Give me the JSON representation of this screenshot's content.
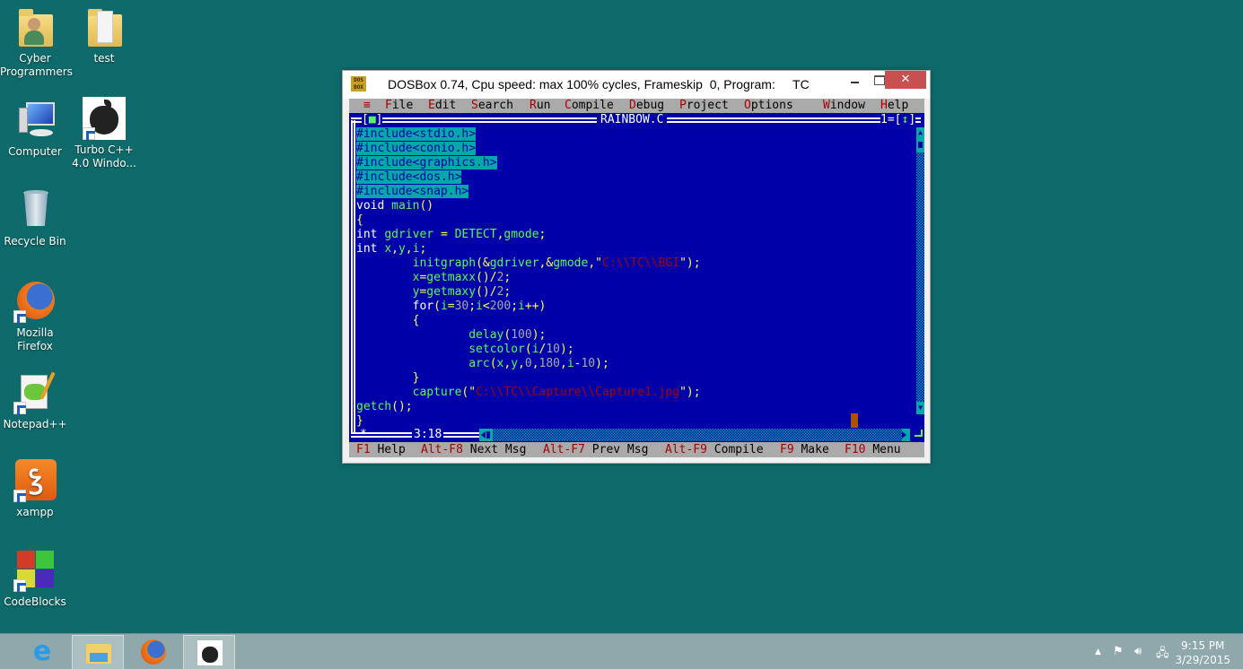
{
  "desktop": {
    "icons": [
      {
        "label_1": "Cyber",
        "label_2": "Programmers",
        "icon": "user-folder-icon"
      },
      {
        "label_1": "test",
        "label_2": "",
        "icon": "folder-icon"
      },
      {
        "label_1": "Computer",
        "label_2": "",
        "icon": "computer-icon"
      },
      {
        "label_1": "Turbo C++",
        "label_2": "4.0 Windo...",
        "icon": "turbo-cpp-shortcut-icon"
      },
      {
        "label_1": "Recycle Bin",
        "label_2": "",
        "icon": "recycle-bin-icon"
      },
      {
        "label_1": "Mozilla",
        "label_2": "Firefox",
        "icon": "firefox-icon"
      },
      {
        "label_1": "Notepad++",
        "label_2": "",
        "icon": "notepadpp-icon"
      },
      {
        "label_1": "xampp",
        "label_2": "",
        "icon": "xampp-icon"
      },
      {
        "label_1": "CodeBlocks",
        "label_2": "",
        "icon": "codeblocks-icon"
      }
    ]
  },
  "window": {
    "title": "DOSBox 0.74, Cpu speed: max 100% cycles, Frameskip  0, Program:     TC",
    "logo_top": "DOS",
    "logo_bottom": "BOX",
    "close_glyph": "✕"
  },
  "tc": {
    "menu": [
      {
        "hotkey": "≡",
        "rest": ""
      },
      {
        "hotkey": "F",
        "rest": "ile"
      },
      {
        "hotkey": "E",
        "rest": "dit"
      },
      {
        "hotkey": "S",
        "rest": "earch"
      },
      {
        "hotkey": "R",
        "rest": "un"
      },
      {
        "hotkey": "C",
        "rest": "ompile"
      },
      {
        "hotkey": "D",
        "rest": "ebug"
      },
      {
        "hotkey": "P",
        "rest": "roject"
      },
      {
        "hotkey": "O",
        "rest": "ptions"
      },
      {
        "hotkey": "W",
        "rest": "indow"
      },
      {
        "hotkey": "H",
        "rest": "elp"
      }
    ],
    "close_box_left": "[",
    "close_box_mark": "■",
    "close_box_right": "]",
    "file_name": "RAINBOW.C",
    "window_number": "1=[",
    "zoom_glyph": "↕",
    "window_number_end": "]",
    "cursor_position": "3:18",
    "code": [
      "#include<stdio.h>",
      "#include<conio.h>",
      "#include<graphics.h>",
      "#include<dos.h>",
      "#include<snap.h>",
      "void main()",
      "{",
      "int gdriver = DETECT,gmode;",
      "int x,y,i;",
      "        initgraph(&gdriver,&gmode,\"C:\\\\TC\\\\BGI\");",
      "        x=getmaxx()/2;",
      "        y=getmaxy()/2;",
      "        for(i=30;i<200;i++)",
      "        {",
      "                delay(100);",
      "                setcolor(i/10);",
      "                arc(x,y,0,180,i-10);",
      "        }",
      "        capture(\"C:\\\\TC\\\\Capture\\\\Capture1.jpg\");",
      "getch();",
      "}"
    ],
    "status": [
      {
        "key": "F1",
        "label": "Help"
      },
      {
        "key": "Alt-F8",
        "label": "Next Msg"
      },
      {
        "key": "Alt-F7",
        "label": "Prev Msg"
      },
      {
        "key": "Alt-F9",
        "label": "Compile"
      },
      {
        "key": "F9",
        "label": "Make"
      },
      {
        "key": "F10",
        "label": "Menu"
      }
    ]
  },
  "taskbar": {
    "apps": [
      {
        "name": "Internet Explorer",
        "icon": "internet-explorer-icon"
      },
      {
        "name": "File Explorer",
        "icon": "file-explorer-icon"
      },
      {
        "name": "Firefox",
        "icon": "firefox-icon"
      },
      {
        "name": "DOSBox Turbo C",
        "icon": "turbo-cpp-icon"
      }
    ],
    "tray_arrow": "▲",
    "time": "9:15 PM",
    "date": "3/29/2015"
  },
  "colors": {
    "desktop_bg": "#0f6b6b",
    "dos_blue": "#0000a8",
    "dos_cyan": "#00a8a8",
    "dos_gray": "#aaaaaa",
    "dos_red": "#a80000",
    "dos_green": "#54fc54",
    "dos_yellow": "#fcfc54",
    "close_red": "#c75050"
  }
}
